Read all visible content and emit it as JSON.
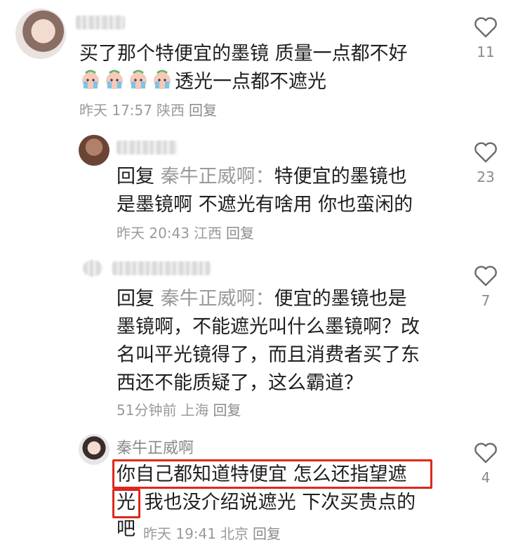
{
  "comments": [
    {
      "name_visible": false,
      "lines": [
        "买了那个特便宜的墨镜 质量一点都不好",
        "透光一点都不遮光"
      ],
      "emoji_count": 4,
      "emoji_icon": "crying-face-icon",
      "time": "昨天 17:57",
      "location": "陕西",
      "reply_label": "回复",
      "likes": "11"
    },
    {
      "name_visible": false,
      "reply_prefix": "回复",
      "reply_target": "秦牛正威啊：",
      "lines": [
        "特便宜的墨镜也",
        "是墨镜啊 不遮光有啥用 你也蛮闲的"
      ],
      "time": "昨天 20:43",
      "location": "江西",
      "reply_label": "回复",
      "likes": "23"
    },
    {
      "name_visible": false,
      "reply_prefix": "回复",
      "reply_target": "秦牛正威啊：",
      "lines": [
        "便宜的墨镜也是",
        "墨镜啊，不能遮光叫什么墨镜啊？改",
        "名叫平光镜得了，而且消费者买了东",
        "西还不能质疑了，这么霸道？"
      ],
      "time": "51分钟前",
      "location": "上海",
      "reply_label": "回复",
      "likes": "7"
    },
    {
      "name": "秦牛正威啊",
      "lines": [
        "你自己都知道特便宜 怎么还指望遮",
        "光",
        "我也没介绍说遮光 下次买贵点的",
        "吧"
      ],
      "time": "昨天 19:41",
      "location": "北京",
      "reply_label": "回复",
      "likes": "4"
    }
  ],
  "colors": {
    "highlight": "#e0271d",
    "meta": "#9a9a9a",
    "text": "#1e1e1e"
  }
}
